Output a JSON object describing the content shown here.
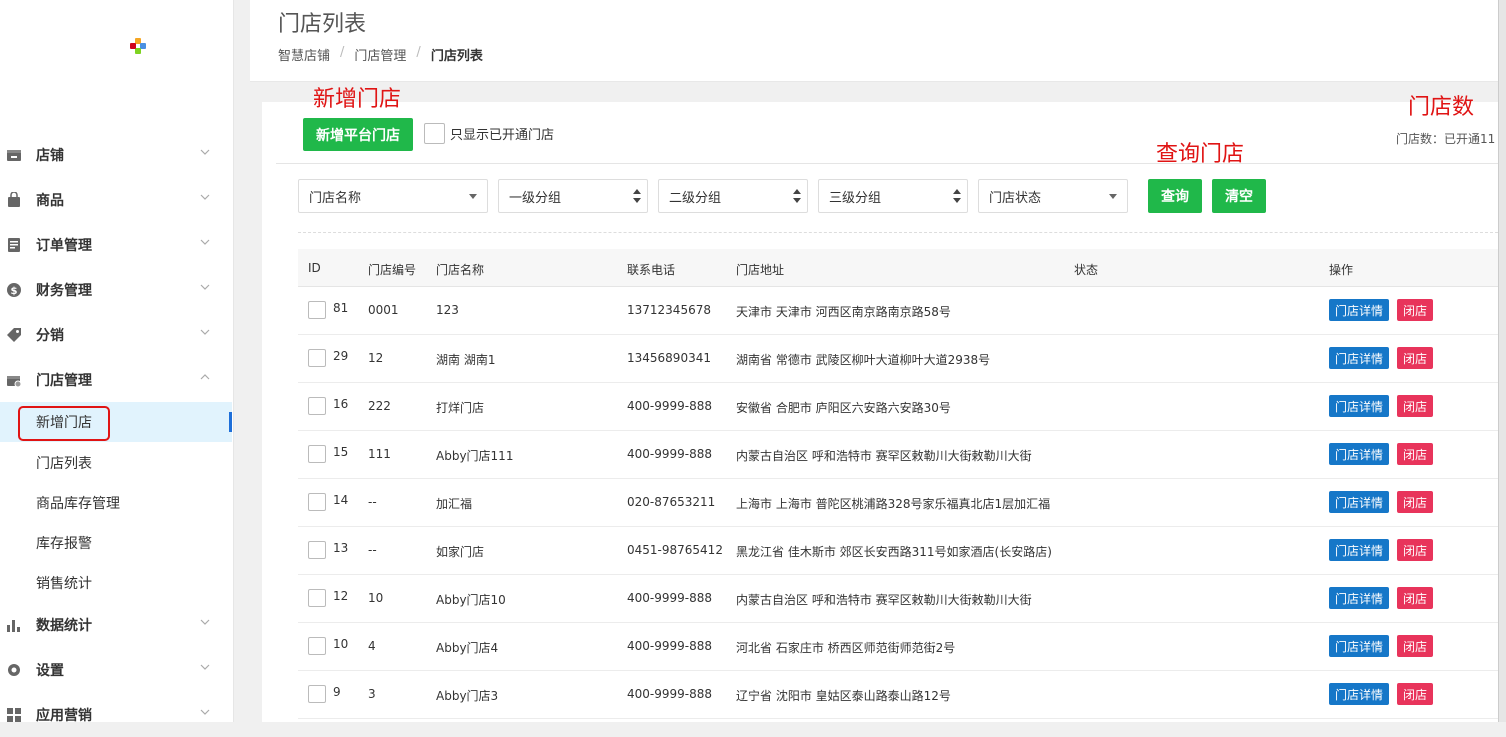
{
  "colors": {
    "primary_green": "#20b84a",
    "detail_blue": "#1677c8",
    "close_red": "#e8345b",
    "annotation_red": "#e01414",
    "active_bg": "#e1f3fd"
  },
  "sidebar": {
    "logo": "logo-icon",
    "items": [
      {
        "label": "店铺",
        "icon": "store-icon"
      },
      {
        "label": "商品",
        "icon": "bag-icon"
      },
      {
        "label": "订单管理",
        "icon": "order-icon"
      },
      {
        "label": "财务管理",
        "icon": "dollar-icon"
      },
      {
        "label": "分销",
        "icon": "tag-icon"
      },
      {
        "label": "门店管理",
        "icon": "shop-gear-icon"
      }
    ],
    "sub_items": [
      {
        "label": "新增门店"
      },
      {
        "label": "门店列表"
      },
      {
        "label": "商品库存管理"
      },
      {
        "label": "库存报警"
      },
      {
        "label": "销售统计"
      }
    ],
    "items_bottom": [
      {
        "label": "数据统计",
        "icon": "bar-chart-icon"
      },
      {
        "label": "设置",
        "icon": "gear-icon"
      },
      {
        "label": "应用营销",
        "icon": "grid-icon"
      }
    ]
  },
  "header": {
    "title": "门店列表",
    "breadcrumb": [
      "智慧店铺",
      "门店管理",
      "门店列表"
    ],
    "separator": "/"
  },
  "annotations": {
    "add_store": "新增门店",
    "store_count": "门店数",
    "query_store": "查询门店"
  },
  "toolbar": {
    "add_button": "新增平台门店",
    "only_open_label": "只显示已开通门店",
    "store_count_text": "门店数：已开通11"
  },
  "filters": {
    "store_name": "门店名称",
    "group1": "一级分组",
    "group2": "二级分组",
    "group3": "三级分组",
    "status": "门店状态",
    "query_button": "查询",
    "clear_button": "清空"
  },
  "table": {
    "headers": [
      "ID",
      "门店编号",
      "门店名称",
      "联系电话",
      "门店地址",
      "状态",
      "操作"
    ],
    "detail_label": "门店详情",
    "close_label": "闭店",
    "rows": [
      {
        "id": "81",
        "code": "0001",
        "name": "123",
        "phone": "13712345678",
        "address": "天津市 天津市 河西区南京路南京路58号",
        "status": ""
      },
      {
        "id": "29",
        "code": "12",
        "name": "湖南 湖南1",
        "phone": "13456890341",
        "address": "湖南省 常德市 武陵区柳叶大道柳叶大道2938号",
        "status": ""
      },
      {
        "id": "16",
        "code": "222",
        "name": "打烊门店",
        "phone": "400-9999-888",
        "address": "安徽省 合肥市 庐阳区六安路六安路30号",
        "status": ""
      },
      {
        "id": "15",
        "code": "111",
        "name": "Abby门店111",
        "phone": "400-9999-888",
        "address": "内蒙古自治区 呼和浩特市 赛罕区敕勒川大街敕勒川大街",
        "status": ""
      },
      {
        "id": "14",
        "code": "--",
        "name": "加汇福",
        "phone": "020-87653211",
        "address": "上海市 上海市 普陀区桃浦路328号家乐福真北店1层加汇福",
        "status": ""
      },
      {
        "id": "13",
        "code": "--",
        "name": "如家门店",
        "phone": "0451-98765412",
        "address": "黑龙江省 佳木斯市 郊区长安西路311号如家酒店(长安路店)",
        "status": ""
      },
      {
        "id": "12",
        "code": "10",
        "name": "Abby门店10",
        "phone": "400-9999-888",
        "address": "内蒙古自治区 呼和浩特市 赛罕区敕勒川大街敕勒川大街",
        "status": ""
      },
      {
        "id": "10",
        "code": "4",
        "name": "Abby门店4",
        "phone": "400-9999-888",
        "address": "河北省 石家庄市 桥西区师范街师范街2号",
        "status": ""
      },
      {
        "id": "9",
        "code": "3",
        "name": "Abby门店3",
        "phone": "400-9999-888",
        "address": "辽宁省 沈阳市 皇姑区泰山路泰山路12号",
        "status": ""
      }
    ]
  }
}
